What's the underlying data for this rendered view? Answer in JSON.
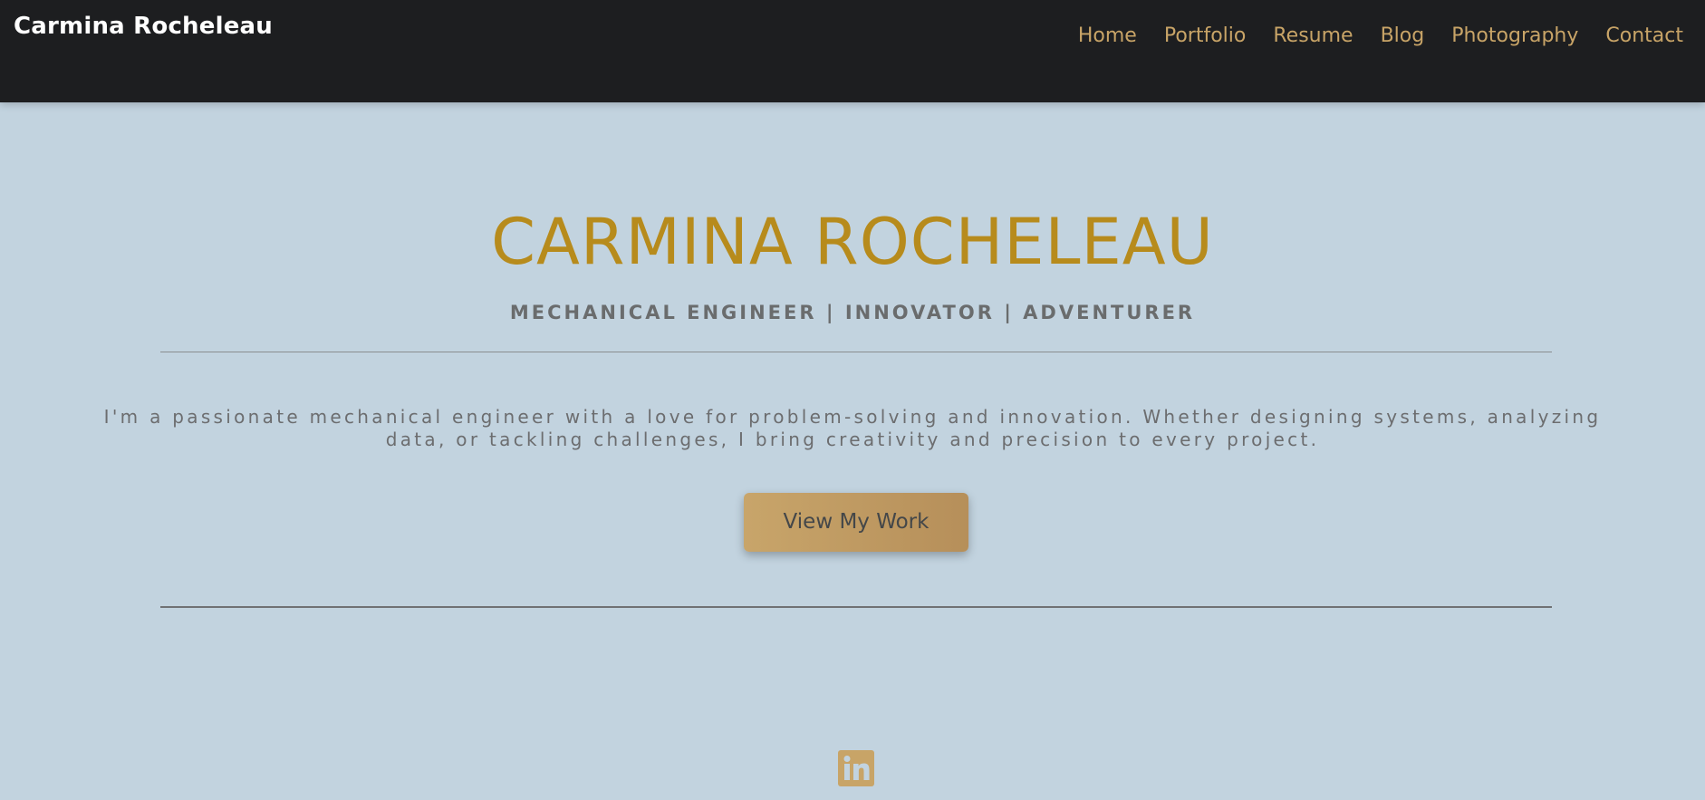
{
  "header": {
    "brand": "Carmina Rocheleau",
    "nav": [
      {
        "label": "Home"
      },
      {
        "label": "Portfolio"
      },
      {
        "label": "Resume"
      },
      {
        "label": "Blog"
      },
      {
        "label": "Photography"
      },
      {
        "label": "Contact"
      }
    ]
  },
  "hero": {
    "title": "CARMINA ROCHELEAU",
    "subtitle": "MECHANICAL ENGINEER | INNOVATOR | ADVENTURER",
    "intro": "I'm a passionate mechanical engineer with a love for problem-solving and innovation. Whether designing systems, analyzing data, or tackling challenges, I bring creativity and precision to every project.",
    "cta_label": "View My Work"
  },
  "social": {
    "icon": "linkedin-icon"
  },
  "colors": {
    "header_bg": "#1d1e20",
    "page_bg": "#c2d3df",
    "accent_gold": "#b78b1c",
    "nav_link": "#c8a467",
    "button_gradient_start": "#c8a56a",
    "button_gradient_end": "#b68f5a"
  }
}
